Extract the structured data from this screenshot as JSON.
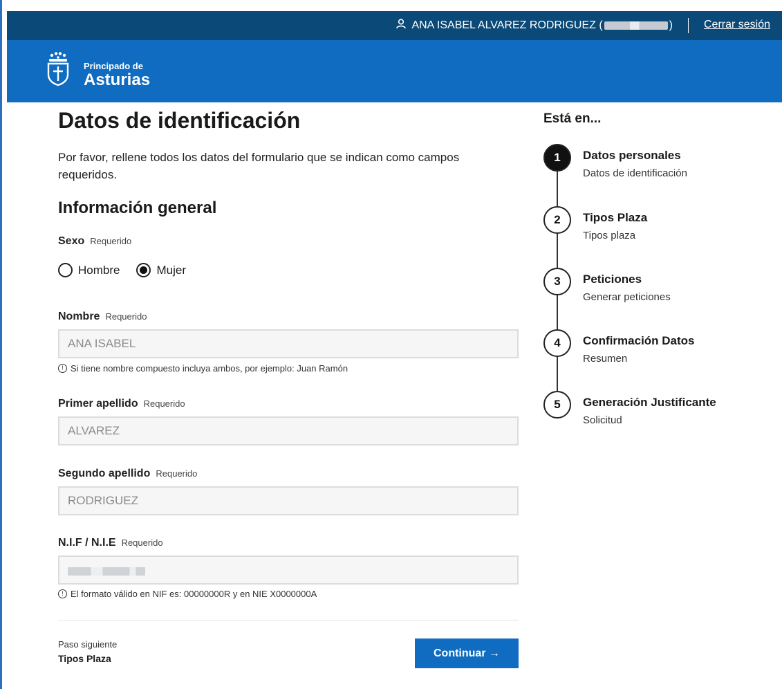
{
  "header": {
    "user_name": "ANA ISABEL ALVAREZ RODRIGUEZ (",
    "user_suffix": ")",
    "logout": "Cerrar sesión"
  },
  "brand": {
    "line1": "Principado de",
    "line2": "Asturias"
  },
  "page": {
    "title": "Datos de identificación",
    "intro": "Por favor, rellene todos los datos del formulario que se indican como campos requeridos.",
    "section": "Información general"
  },
  "form": {
    "required": "Requerido",
    "sexo": {
      "label": "Sexo",
      "options": [
        "Hombre",
        "Mujer"
      ],
      "selected": "Mujer"
    },
    "nombre": {
      "label": "Nombre",
      "value": "ANA ISABEL",
      "hint": "Si tiene nombre compuesto incluya ambos, por ejemplo: Juan Ramón"
    },
    "apellido1": {
      "label": "Primer apellido",
      "value": "ALVAREZ"
    },
    "apellido2": {
      "label": "Segundo apellido",
      "value": "RODRIGUEZ"
    },
    "nif": {
      "label": "N.I.F / N.I.E",
      "value": "",
      "hint": "El formato válido en NIF es: 00000000R y en NIE X0000000A"
    }
  },
  "footer": {
    "next_label": "Paso siguiente",
    "next_value": "Tipos Plaza",
    "continue": "Continuar →"
  },
  "stepper": {
    "title": "Está en...",
    "steps": [
      {
        "num": "1",
        "title": "Datos personales",
        "sub": "Datos de identificación",
        "active": true
      },
      {
        "num": "2",
        "title": "Tipos Plaza",
        "sub": "Tipos plaza",
        "active": false
      },
      {
        "num": "3",
        "title": "Peticiones",
        "sub": "Generar peticiones",
        "active": false
      },
      {
        "num": "4",
        "title": "Confirmación Datos",
        "sub": "Resumen",
        "active": false
      },
      {
        "num": "5",
        "title": "Generación Justificante",
        "sub": "Solicitud",
        "active": false
      }
    ]
  },
  "colors": {
    "topbar": "#0b4a78",
    "brandbar": "#0f6cc1",
    "button": "#0f6cc1"
  },
  "icons": {
    "user": "user-icon",
    "logo": "asturias-shield-logo",
    "info": "info-icon"
  }
}
